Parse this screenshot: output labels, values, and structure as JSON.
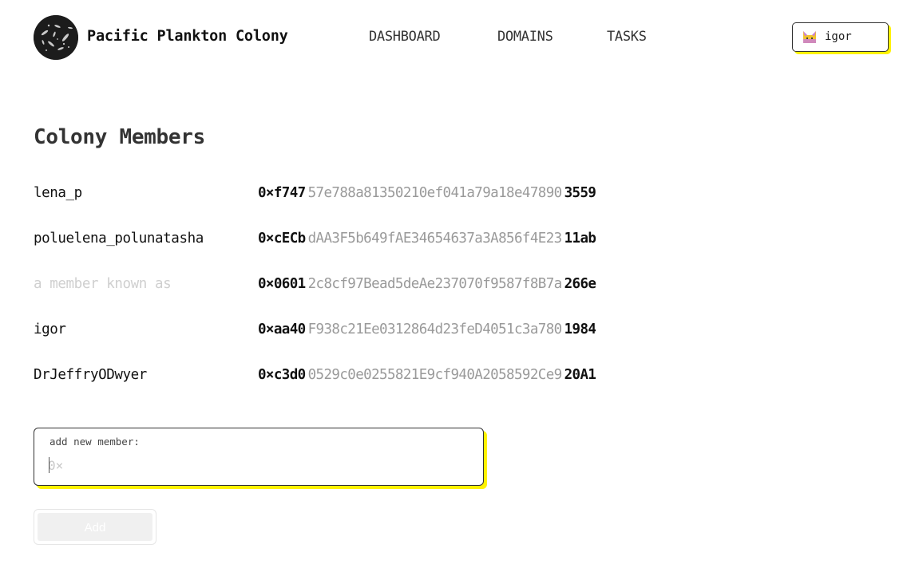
{
  "header": {
    "brand": "Pacific Plankton Colony",
    "nav": [
      {
        "label": "DASHBOARD"
      },
      {
        "label": "DOMAINS"
      },
      {
        "label": "TASKS"
      }
    ],
    "user": {
      "name": "igor",
      "avatar_icon": "cat-avatar-icon"
    }
  },
  "main": {
    "title": "Colony Members",
    "members": [
      {
        "name": "lena_p",
        "addr_head": "0×f747",
        "addr_mid": "57e788a81350210ef041a79a18e47890",
        "addr_tail": "3559"
      },
      {
        "name": "poluelena_polunatasha",
        "addr_head": "0×cECb",
        "addr_mid": "dAA3F5b649fAE34654637a3A856f4E23",
        "addr_tail": "11ab"
      },
      {
        "name": "a member known as",
        "addr_head": "0×0601",
        "addr_mid": "2c8cf97Bead5deAe237070f9587f8B7a",
        "addr_tail": "266e",
        "unknown": true
      },
      {
        "name": "igor",
        "addr_head": "0×aa40",
        "addr_mid": "F938c21Ee0312864d23feD4051c3a780",
        "addr_tail": "1984"
      },
      {
        "name": "DrJeffryODwyer",
        "addr_head": "0×c3d0",
        "addr_mid": "0529c0e0255821E9cf940A2058592Ce9",
        "addr_tail": "20A1"
      }
    ],
    "add_member": {
      "label": "add new member:",
      "placeholder": "0×",
      "value": "",
      "button_label": "Add"
    }
  },
  "colors": {
    "accent_shadow": "#fff200",
    "address_muted": "#9a9a9a",
    "unknown_name": "#cfcfcf"
  }
}
